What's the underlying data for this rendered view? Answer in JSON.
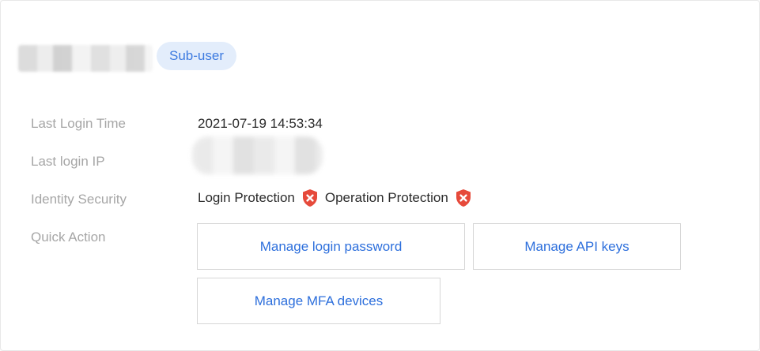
{
  "user": {
    "role_badge": "Sub-user"
  },
  "info": {
    "last_login_time_label": "Last Login Time",
    "last_login_time_value": "2021-07-19 14:53:34",
    "last_login_ip_label": "Last login IP",
    "identity_security_label": "Identity Security",
    "login_protection": "Login Protection",
    "operation_protection": "Operation Protection",
    "quick_action_label": "Quick Action"
  },
  "actions": {
    "manage_password": "Manage login password",
    "manage_api_keys": "Manage API keys",
    "manage_mfa": "Manage MFA devices"
  },
  "colors": {
    "accent": "#2d6fdc",
    "badge_bg": "#e3edfb",
    "badge_text": "#3e7be0",
    "shield_red": "#e64a3b",
    "label_grey": "#a6a6a6"
  },
  "icons": {
    "protection_status": "shield-x-icon"
  }
}
